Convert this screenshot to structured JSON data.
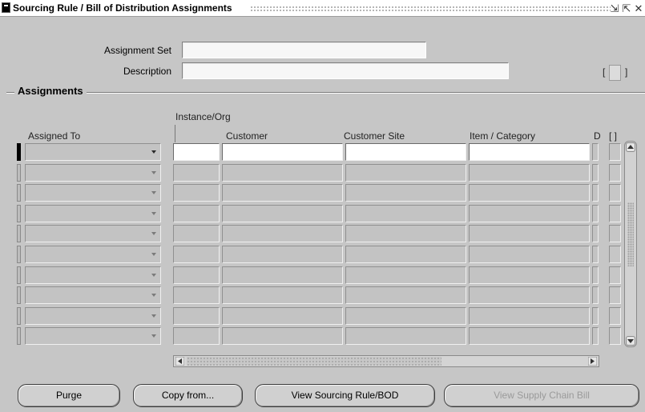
{
  "window": {
    "title": "Sourcing Rule / Bill of Distribution Assignments",
    "controls": [
      "minimize-icon",
      "maximize-icon",
      "close-icon"
    ]
  },
  "header": {
    "assignment_set_label": "Assignment Set",
    "assignment_set_value": "",
    "description_label": "Description",
    "description_value": "",
    "flex_bracket_open": "[",
    "flex_bracket_close": "]"
  },
  "assignments": {
    "section_title": "Assignments",
    "column_headers": {
      "assigned_to": "Assigned To",
      "instance_org": "Instance/Org",
      "customer": "Customer",
      "customer_site": "Customer Site",
      "item_category": "Item / Category",
      "truncated": "D",
      "bracket": "[ ]"
    },
    "row_count": 10
  },
  "buttons": {
    "purge": "Purge",
    "copy_from": "Copy from...",
    "view_sourcing_rule": "View Sourcing Rule/BOD",
    "view_supply_chain_bill": "View Supply Chain Bill"
  },
  "colors": {
    "window_bg": "#c6c6c6",
    "active_field": "#ffffff",
    "disabled_text": "#9a9a9a"
  }
}
